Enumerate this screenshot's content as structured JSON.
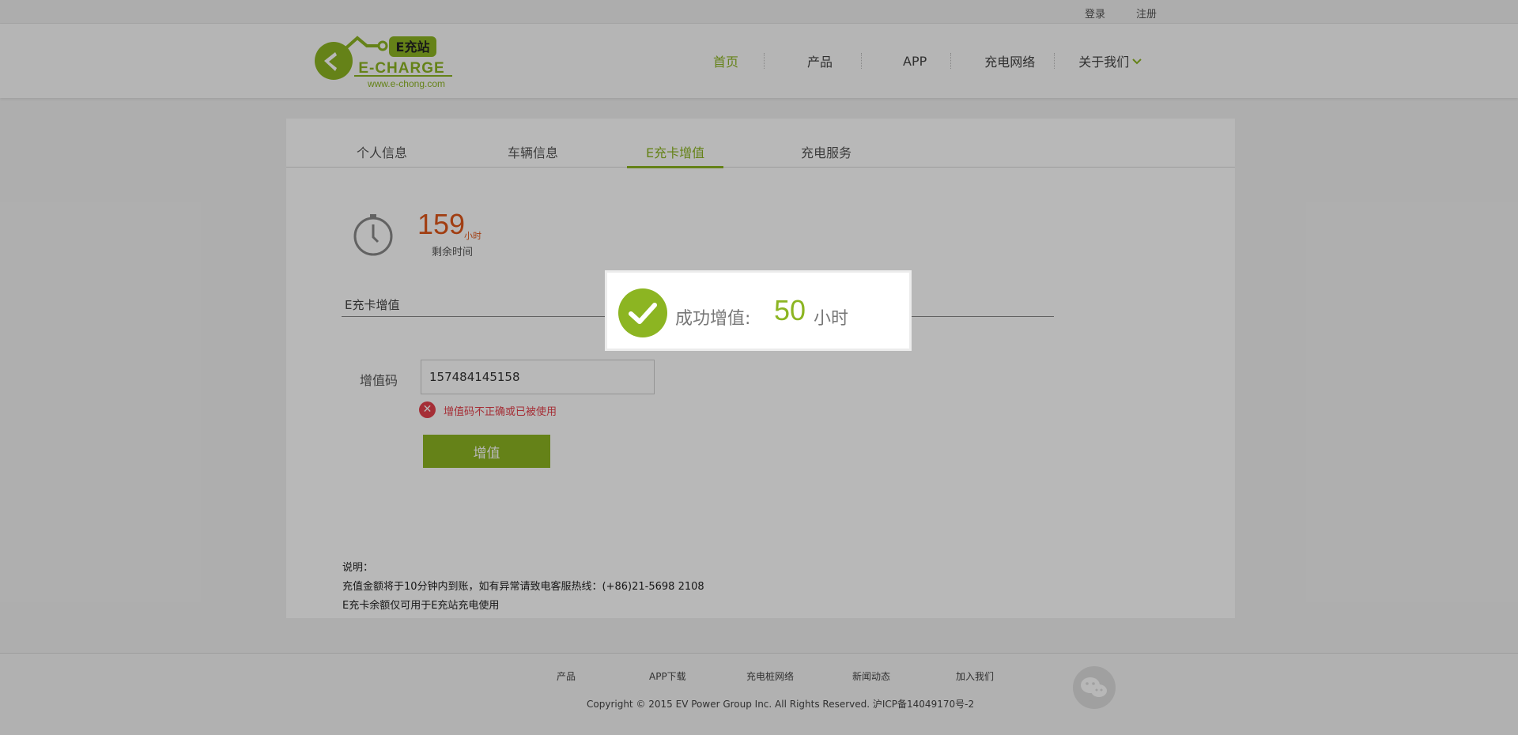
{
  "topbar": {
    "login": "登录",
    "register": "注册"
  },
  "logo": {
    "badge": "E充站",
    "wordmark": "E-CHARGE",
    "url": "www.e-chong.com"
  },
  "nav": {
    "items": [
      {
        "label": "首页",
        "active": true
      },
      {
        "label": "产品"
      },
      {
        "label": "APP"
      },
      {
        "label": "充电网络"
      },
      {
        "label": "关于我们",
        "has_dropdown": true
      }
    ]
  },
  "tabs": [
    {
      "label": "个人信息"
    },
    {
      "label": "车辆信息"
    },
    {
      "label": "E充卡增值",
      "active": true
    },
    {
      "label": "充电服务"
    }
  ],
  "balance": {
    "value": "159",
    "unit": "小时",
    "label": "剩余时间",
    "icon": "clock-icon"
  },
  "section_title": "E充卡增值",
  "form": {
    "code_label": "增值码",
    "code_value": "157484145158",
    "error_text": "增值码不正确或已被使用",
    "error_icon": "error-x-icon",
    "submit_label": "增值"
  },
  "notes": {
    "title": "说明：",
    "line1": "充值金额将于10分钟内到账，如有异常请致电客服热线：(+86)21-5698 2108",
    "line2": "E充卡余额仅可用于E充站充电使用"
  },
  "footer": {
    "links": [
      "产品",
      "APP下载",
      "充电桩网络",
      "新闻动态",
      "加入我们"
    ],
    "copyright": "Copyright © 2015 EV Power Group Inc. All Rights Reserved. 沪ICP备14049170号-2",
    "wechat_icon": "wechat-icon"
  },
  "modal": {
    "label": "成功增值:",
    "value": "50",
    "unit": "小时",
    "icon": "check-circle-icon"
  },
  "colors": {
    "brand_green": "#8cb522",
    "balance_orange": "#e0561a",
    "error_red": "#e5404b"
  }
}
